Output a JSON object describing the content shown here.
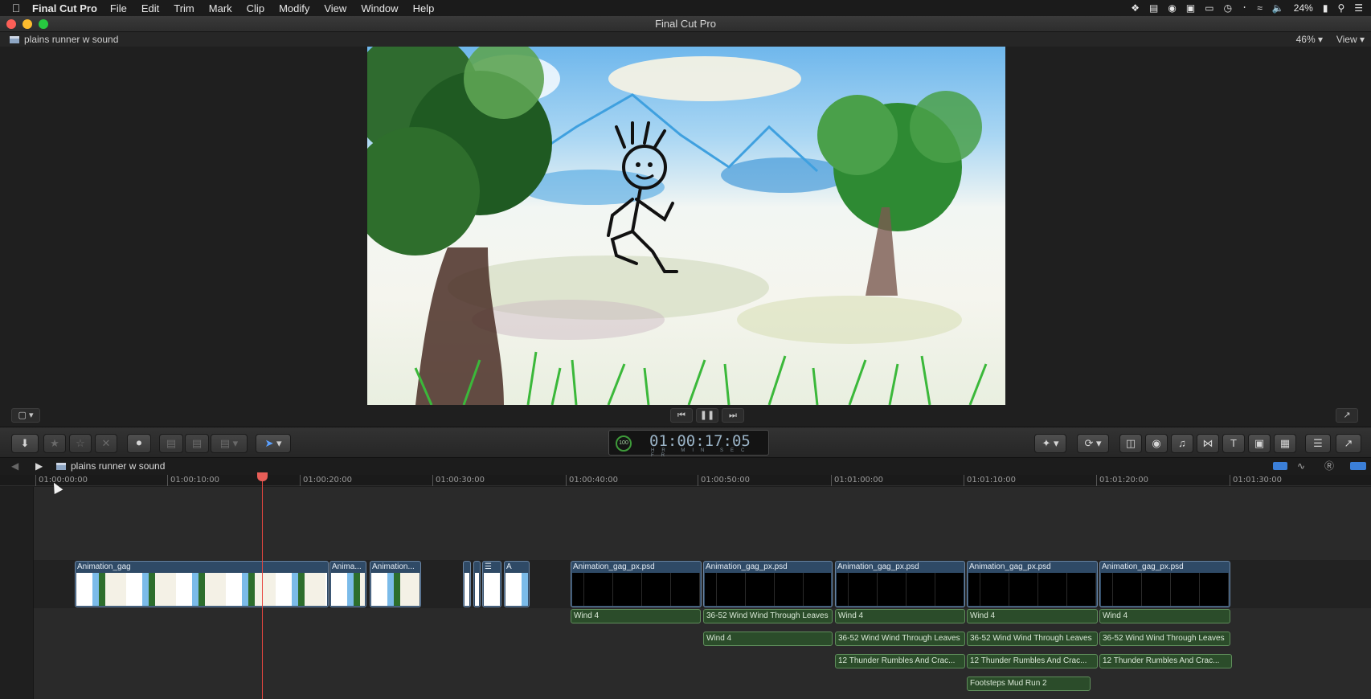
{
  "menubar": {
    "app_name": "Final Cut Pro",
    "items": [
      "File",
      "Edit",
      "Trim",
      "Mark",
      "Clip",
      "Modify",
      "View",
      "Window",
      "Help"
    ],
    "battery": "24%"
  },
  "window": {
    "title": "Final Cut Pro"
  },
  "viewer": {
    "project_name": "plains runner w sound",
    "zoom": "46%",
    "view_label": "View"
  },
  "toolbar": {
    "timecode": "01:00:17:05",
    "timecode_units": "HR MIN SEC FR",
    "speed": "100"
  },
  "timeline": {
    "project_name": "plains runner w sound",
    "ruler": [
      "01:00:00:00",
      "01:00:10:00",
      "01:00:20:00",
      "01:00:30:00",
      "01:00:40:00",
      "01:00:50:00",
      "01:01:00:00",
      "01:01:10:00",
      "01:01:20:00",
      "01:01:30:00"
    ],
    "video_clips": [
      "Animation_gag",
      "Anima...",
      "Animation...",
      "A",
      "Animation_gag_px.psd",
      "Animation_gag_px.psd",
      "Animation_gag_px.psd",
      "Animation_gag_px.psd",
      "Animation_gag_px.psd"
    ],
    "audio_row1": [
      "Wind 4",
      "36-52 Wind Wind Through Leaves",
      "Wind 4",
      "Wind 4",
      "Wind 4"
    ],
    "audio_row2": [
      "Wind 4",
      "36-52 Wind Wind Through Leaves",
      "36-52 Wind Wind Through Leaves",
      "36-52 Wind Wind Through Leaves"
    ],
    "audio_row3": [
      "12 Thunder Rumbles And Crac...",
      "12 Thunder Rumbles And Crac...",
      "12 Thunder Rumbles And Crac..."
    ],
    "audio_row4": [
      "Footsteps Mud Run 2"
    ]
  }
}
